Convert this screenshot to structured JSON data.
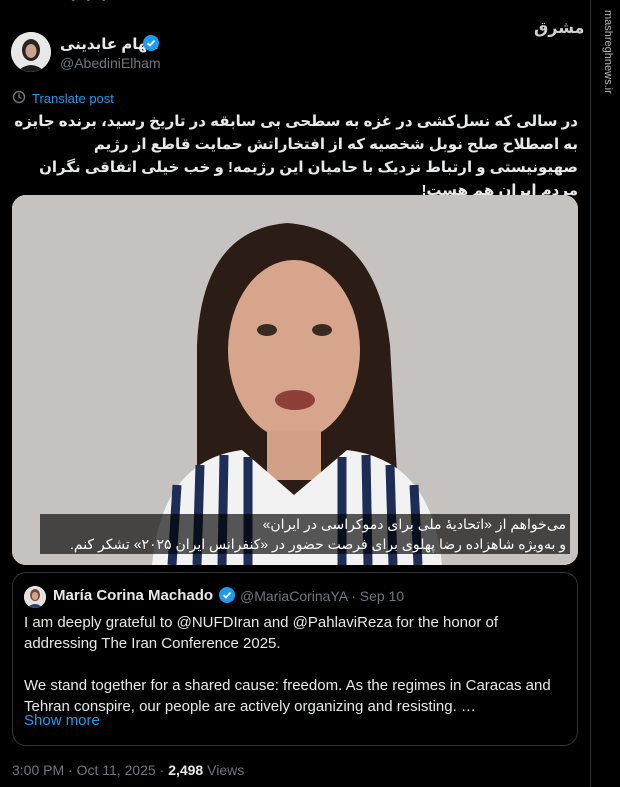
{
  "author": {
    "display_name": "الهام عابدینی",
    "handle": "@AbediniElham",
    "verified": true
  },
  "translate_label": "Translate post",
  "tweet_text": "در سالی که نسل‌کشی در غزه به سطحی بی سابقه در تاریخ رسید، برنده جایزه به اصطلاح صلح نوبل شخصیه که از افتخاراتش حمایت قاطع از رژیم صهیونیستی و ارتباط نزدیک با حامیان این رژیمه! و خب خیلی اتفاقی نگران مردم ایران هم هست!",
  "video": {
    "subtitle_line1": "می‌خواهم از «اتحادیهٔ ملی برای دموکراسی در ایران»",
    "subtitle_line2": "و به‌ویژه شاهزاده رضا پهلوی برای فرصت حضور در «کنفرانس ایران ۲۰۲۵» تشکر کنم."
  },
  "quoted": {
    "name": "María Corina Machado",
    "handle": "@MariaCorinaYA",
    "date": "Sep 10",
    "verified": true,
    "para1": "I am deeply grateful to @NUFDIran and @PahlaviReza for the honor of addressing The Iran Conference 2025.",
    "para2": "We stand together for a shared cause: freedom. As the regimes in Caracas and Tehran conspire, our people are actively organizing and resisting. …",
    "show_more": "Show more"
  },
  "footer": {
    "time": "3:00 PM",
    "date": "Oct 11, 2025",
    "views_count": "2,498",
    "views_label": "Views"
  },
  "watermark": {
    "site": "mashreghnews.ir",
    "logo": "مشرق"
  },
  "colors": {
    "background": "#000000",
    "accent": "#1d9bf0",
    "muted": "#71767b",
    "text": "#e7e9ea"
  }
}
